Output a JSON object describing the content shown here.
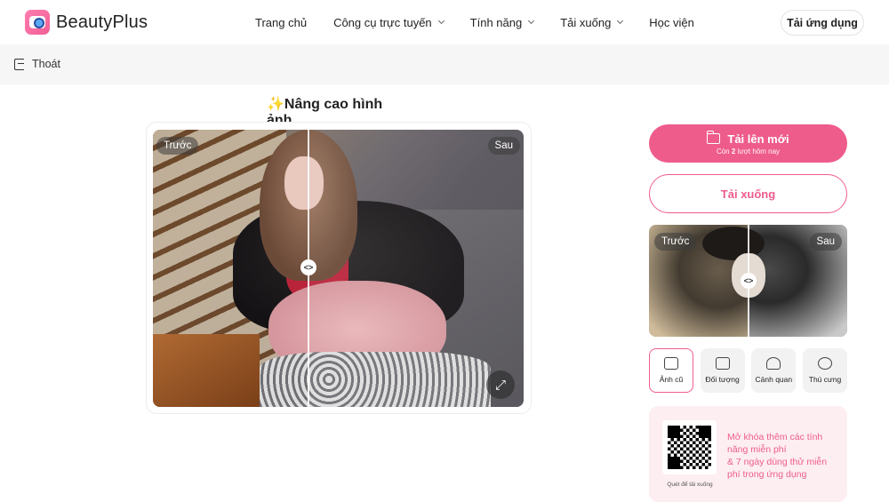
{
  "brand": {
    "name": "BeautyPlus"
  },
  "nav": {
    "items": [
      {
        "label": "Trang chủ",
        "has_dropdown": false
      },
      {
        "label": "Công cụ trực tuyến",
        "has_dropdown": true
      },
      {
        "label": "Tính năng",
        "has_dropdown": true
      },
      {
        "label": "Tải xuống",
        "has_dropdown": true
      },
      {
        "label": "Học viện",
        "has_dropdown": false
      }
    ],
    "app_button": "Tải ứng dụng"
  },
  "subbar": {
    "exit_label": "Thoát"
  },
  "main": {
    "title": "✨Nâng cao hình ảnh",
    "compare": {
      "before_label": "Trước",
      "after_label": "Sau",
      "handle_glyph": "<>",
      "expand_glyph": "⤢"
    }
  },
  "panel": {
    "upload": {
      "label": "Tải lên mới",
      "sub_prefix": "Còn ",
      "sub_count": "2",
      "sub_suffix": " lượt hôm nay"
    },
    "download_label": "Tải xuống",
    "preview": {
      "before_label": "Trước",
      "after_label": "Sau",
      "handle_glyph": "<>"
    },
    "tools": [
      {
        "label": "Ảnh cũ",
        "active": true
      },
      {
        "label": "Đối tượng",
        "active": false
      },
      {
        "label": "Cảnh quan",
        "active": false
      },
      {
        "label": "Thú cưng",
        "active": false
      }
    ],
    "promo": {
      "qr_caption": "Quét để tải xuống",
      "line1": "Mở khóa thêm các tính năng miễn phí",
      "line2": "& 7 ngày dùng thử miễn phí trong ứng dụng"
    }
  },
  "colors": {
    "accent": "#ee5c8c",
    "subbar_bg": "#f6f6f7",
    "promo_bg": "#fdeef1"
  }
}
